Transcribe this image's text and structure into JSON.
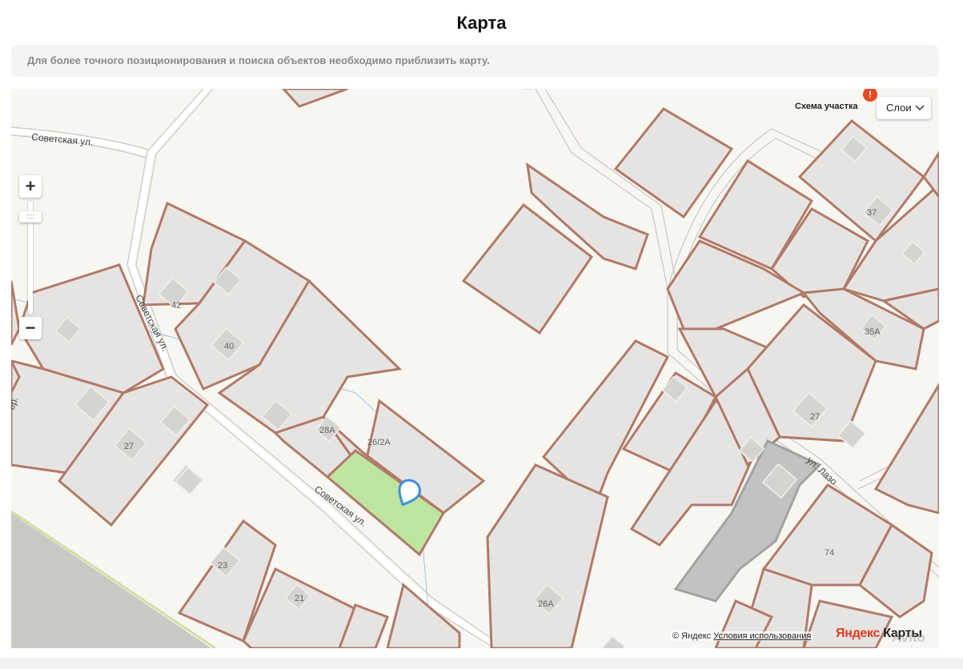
{
  "page": {
    "title": "Карта",
    "hint": "Для более точного позиционирования и поиска объектов необходимо приблизить карту."
  },
  "map": {
    "controls": {
      "zoom_in_label": "+",
      "zoom_out_label": "−",
      "zoom_handle_label": "::::",
      "scheme_label": "Схема участка",
      "alert_label": "!",
      "layers_label": "Слои"
    },
    "streets": [
      {
        "id": "sovetskaya-top",
        "name": "Советская ул."
      },
      {
        "id": "sovetskaya-diag",
        "name": "Советская ул."
      },
      {
        "id": "sovetskaya-bottom",
        "name": "Советская ул."
      },
      {
        "id": "lazo",
        "name": "ул. Лазо"
      },
      {
        "id": "per-edge",
        "name": "ер."
      }
    ],
    "parcel_labels": [
      "42",
      "40",
      "27",
      "28А",
      "26/2А",
      "37",
      "35А",
      "27",
      "74",
      "23",
      "21",
      "26А"
    ],
    "selected_parcel_color": "#bde5a0",
    "highlighted_parcel_color": "#c2c2c2",
    "marker_color": "#3d8fe0",
    "attribution": {
      "copyright": "© Яндекс",
      "terms": "Условия использования",
      "brand_part1": "Яндекс",
      "brand_part2": " Карты"
    },
    "watermark": "Avito"
  }
}
